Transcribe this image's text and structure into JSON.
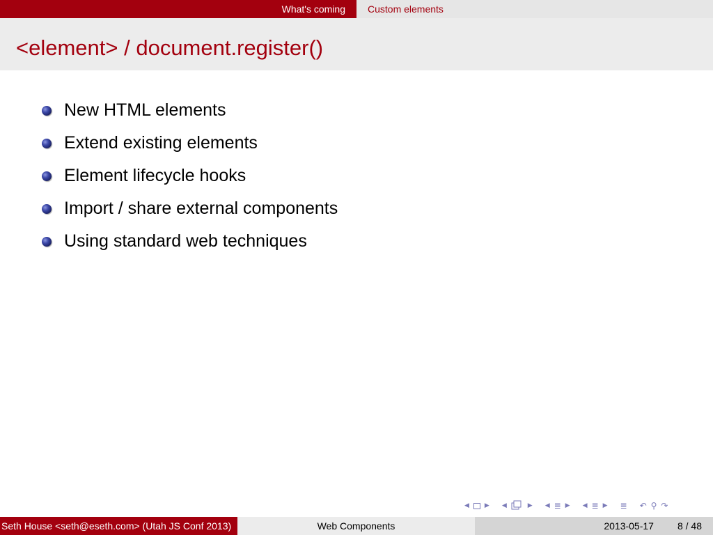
{
  "nav": {
    "section_previous": "What's coming",
    "section_current": "Custom elements"
  },
  "frame": {
    "title": "<element> / document.register()"
  },
  "bullets": [
    "New HTML elements",
    "Extend existing elements",
    "Element lifecycle hooks",
    "Import / share external components",
    "Using standard web techniques"
  ],
  "footer": {
    "author": "Seth House <seth@eseth.com>  (Utah JS Conf 2013)",
    "title": "Web Components",
    "date": "2013-05-17",
    "page": "8 / 48"
  },
  "colors": {
    "accent": "#a3000e",
    "bar_light": "#ececec",
    "bar_mid": "#d5d5d5",
    "nav_symbol": "#7a7ab8"
  },
  "icons": {
    "bullet": "ball-bullet-icon",
    "nav": [
      "arrow-left-icon",
      "frame-icon",
      "arrow-right-icon",
      "subsection-icon",
      "section-icon",
      "back-icon",
      "search-icon",
      "forward-icon"
    ]
  }
}
